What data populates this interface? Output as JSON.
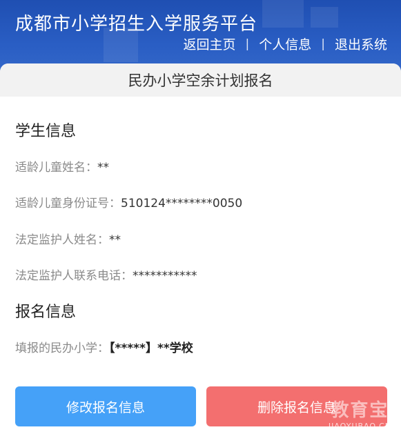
{
  "header": {
    "site_title": "成都市小学招生入学服务平台",
    "nav": [
      {
        "label": "返回主页"
      },
      {
        "label": "个人信息"
      },
      {
        "label": "退出系统"
      }
    ],
    "separator": "|"
  },
  "page": {
    "heading": "民办小学空余计划报名"
  },
  "student_section": {
    "title": "学生信息",
    "fields": [
      {
        "label": "适龄儿童姓名：",
        "value": "**"
      },
      {
        "label": "适龄儿童身份证号：",
        "value": "510124********0050"
      },
      {
        "label": "法定监护人姓名：",
        "value": "**"
      },
      {
        "label": "法定监护人联系电话：",
        "value": "***********"
      }
    ]
  },
  "signup_section": {
    "title": "报名信息",
    "fields": [
      {
        "label": "填报的民办小学：",
        "value": "【*****】**学校"
      }
    ]
  },
  "actions": {
    "edit_label": "修改报名信息",
    "delete_label": "删除报名信息"
  },
  "watermark": {
    "cn": "教育宝",
    "en": "JIAOYUBAO.CN"
  },
  "colors": {
    "header_blue": "#2a5ec4",
    "edit_button": "#45a1f8",
    "delete_button": "#f36f6f",
    "heading_bar": "#f2f2f2"
  }
}
